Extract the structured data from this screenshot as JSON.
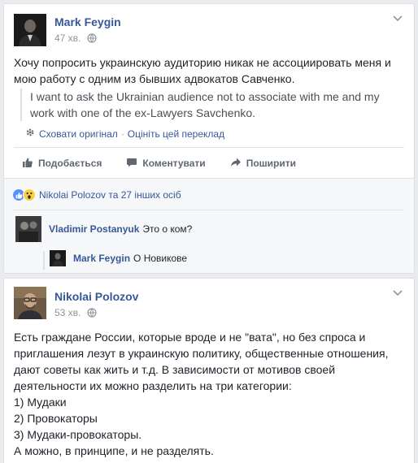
{
  "post1": {
    "author": "Mark Feygin",
    "time": "47 хв.",
    "text": "Хочу попросить украинскую аудиторию никак не ассоциировать меня и мою работу с одним из бывших адвокатов Савченко.",
    "translation": "I want to ask the Ukrainian audience not to associate with me and my work with one of the ex-Lawyers Savchenko.",
    "hide_original": "Сховати оригінал",
    "rate_translation": "Оцініть цей переклад",
    "separator": "·",
    "actions": {
      "like": "Подобається",
      "comment": "Коментувати",
      "share": "Поширити"
    },
    "reactions_text": "Nikolai Polozov та 27 інших осіб",
    "comments": [
      {
        "author": "Vladimir Postanyuk",
        "text": "Это о ком?"
      },
      {
        "author": "Mark Feygin",
        "text": "О Новикове"
      }
    ]
  },
  "post2": {
    "author": "Nikolai Polozov",
    "time": "53 хв.",
    "lines": [
      "Есть граждане России, которые вроде и не \"вата\", но без спроса и приглашения лезут в украинскую политику, общественные отношения, дают советы как жить и т.д. В зависимости от мотивов своей деятельности их можно разделить на три категории:",
      "1) Мудаки",
      "2) Провокаторы",
      "3) Мудаки-провокаторы.",
      "А можно, в принципе, и не разделять."
    ]
  },
  "colors": {
    "link": "#365899",
    "meta": "#90949c",
    "background": "#e9ebee",
    "like_reaction": "#5890ff",
    "wow_reaction": "#f7d046"
  },
  "icons": {
    "menu": "chevron-down-icon",
    "privacy": "globe-icon",
    "settings": "gear-icon",
    "like": "thumbs-up-icon",
    "comment": "speech-bubble-icon",
    "share": "share-arrow-icon"
  }
}
